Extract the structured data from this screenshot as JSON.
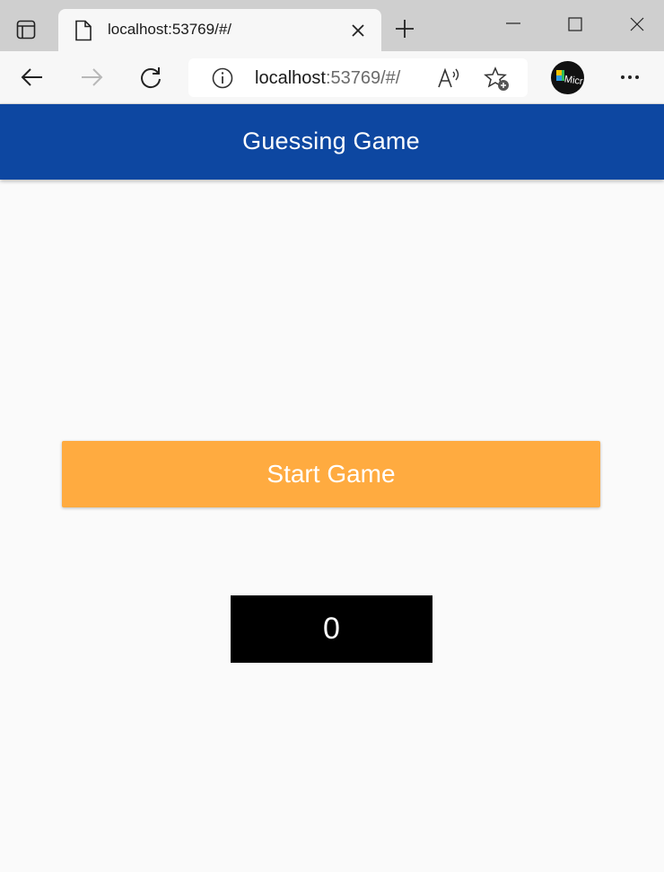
{
  "browser": {
    "tab_title": "localhost:53769/#/",
    "address_host": "localhost",
    "address_rest": ":53769/#/",
    "icons": [
      "tab-actions-icon",
      "page-icon",
      "close-icon",
      "plus-icon",
      "minimize-icon",
      "maximize-icon",
      "window-close-icon",
      "back-arrow-icon",
      "forward-arrow-icon",
      "reload-icon",
      "info-icon",
      "read-aloud-icon",
      "add-favorite-icon",
      "profile-avatar",
      "more-dots-icon"
    ]
  },
  "app": {
    "title": "Guessing Game",
    "start_button_label": "Start Game",
    "counter_value": "0",
    "colors": {
      "appbar": "#0d47a1",
      "button": "#ffab40",
      "counter_bg": "#000000",
      "page_bg": "#fafafa"
    }
  }
}
